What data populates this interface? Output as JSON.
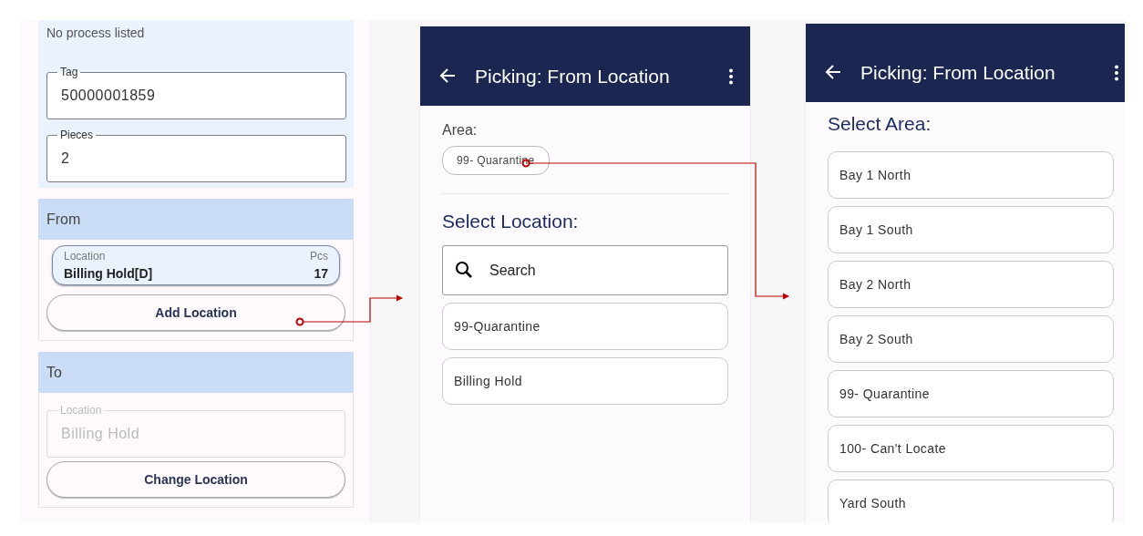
{
  "left_screen": {
    "status_text": "No process listed",
    "fields": [
      {
        "label": "Tag",
        "value": "50000001859"
      },
      {
        "label": "Pieces",
        "value": "2"
      }
    ],
    "from": {
      "heading": "From",
      "location_card": {
        "label": "Location",
        "count_label": "Pcs",
        "value": "Billing Hold[D]",
        "count": "17"
      },
      "button": "Add Location"
    },
    "to": {
      "heading": "To",
      "field": {
        "label": "Location",
        "value": "Billing Hold",
        "disabled": true
      },
      "button": "Change Location"
    }
  },
  "location_screen": {
    "title": "Picking: From Location",
    "area_label": "Area:",
    "area_chip": "99- Quarantine",
    "heading": "Select Location:",
    "search": {
      "placeholder": "Search"
    },
    "items": [
      "99-Quarantine",
      "Billing Hold"
    ]
  },
  "area_screen": {
    "title": "Picking: From Location",
    "heading": "Select Area:",
    "items": [
      "Bay 1 North",
      "Bay 1 South",
      "Bay 2 North",
      "Bay 2 South",
      "99- Quarantine",
      "100- Can't Locate",
      "Yard South"
    ]
  }
}
